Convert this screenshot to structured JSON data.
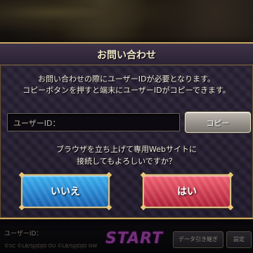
{
  "dialog": {
    "title": "お問い合わせ",
    "message_lines": [
      "お問い合わせの際にユーザーIDが必要となります。",
      "コピーボタンを押すと端末にユーザーIDがコピーできます。"
    ],
    "user_id_label": "ユーザーID：",
    "copy_button": "コピー",
    "question_lines": [
      "ブラウザを立ち上げて専用Webサイトに",
      "接続してもよろしいですか？"
    ],
    "no_button": "いいえ",
    "yes_button": "はい"
  },
  "background": {
    "user_id_label": "ユーザーID：",
    "copyright": "©SC ©LB/SJ/JOJO DU ©LB/SJ/JOJO GW",
    "logo_text": "START",
    "data_button": "データ引き継ぎ",
    "settings_button": "設定"
  },
  "colors": {
    "accent_gold": "#c9a860",
    "no_button": "#2a8ad8",
    "yes_button": "#d83850"
  }
}
